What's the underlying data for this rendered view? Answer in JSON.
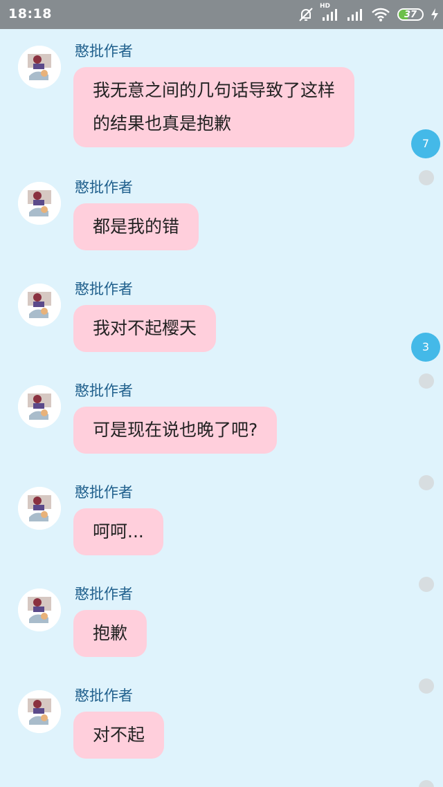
{
  "status_bar": {
    "time": "18:18",
    "network_label": "HD",
    "battery_level": "37"
  },
  "chat": {
    "messages": [
      {
        "sender": "憨批作者",
        "lines": [
          "我无意之间的几句话导致了这样",
          "的结果也真是抱歉"
        ]
      },
      {
        "sender": "憨批作者",
        "text": "都是我的错"
      },
      {
        "sender": "憨批作者",
        "text": "我对不起樱天"
      },
      {
        "sender": "憨批作者",
        "text": "可是现在说也晚了吧?"
      },
      {
        "sender": "憨批作者",
        "text": "呵呵..."
      },
      {
        "sender": "憨批作者",
        "text": "抱歉"
      },
      {
        "sender": "憨批作者",
        "text": "对不起"
      }
    ],
    "badges": [
      "7",
      "3"
    ]
  },
  "colors": {
    "background": "#dff3fc",
    "bubble": "#ffcfdc",
    "sender": "#1f5f8c",
    "badge": "#44b9e8",
    "status_bar": "#868c90"
  },
  "icons": [
    "mute-bell-icon",
    "signal-icon",
    "wifi-icon",
    "battery-icon",
    "charging-icon"
  ]
}
